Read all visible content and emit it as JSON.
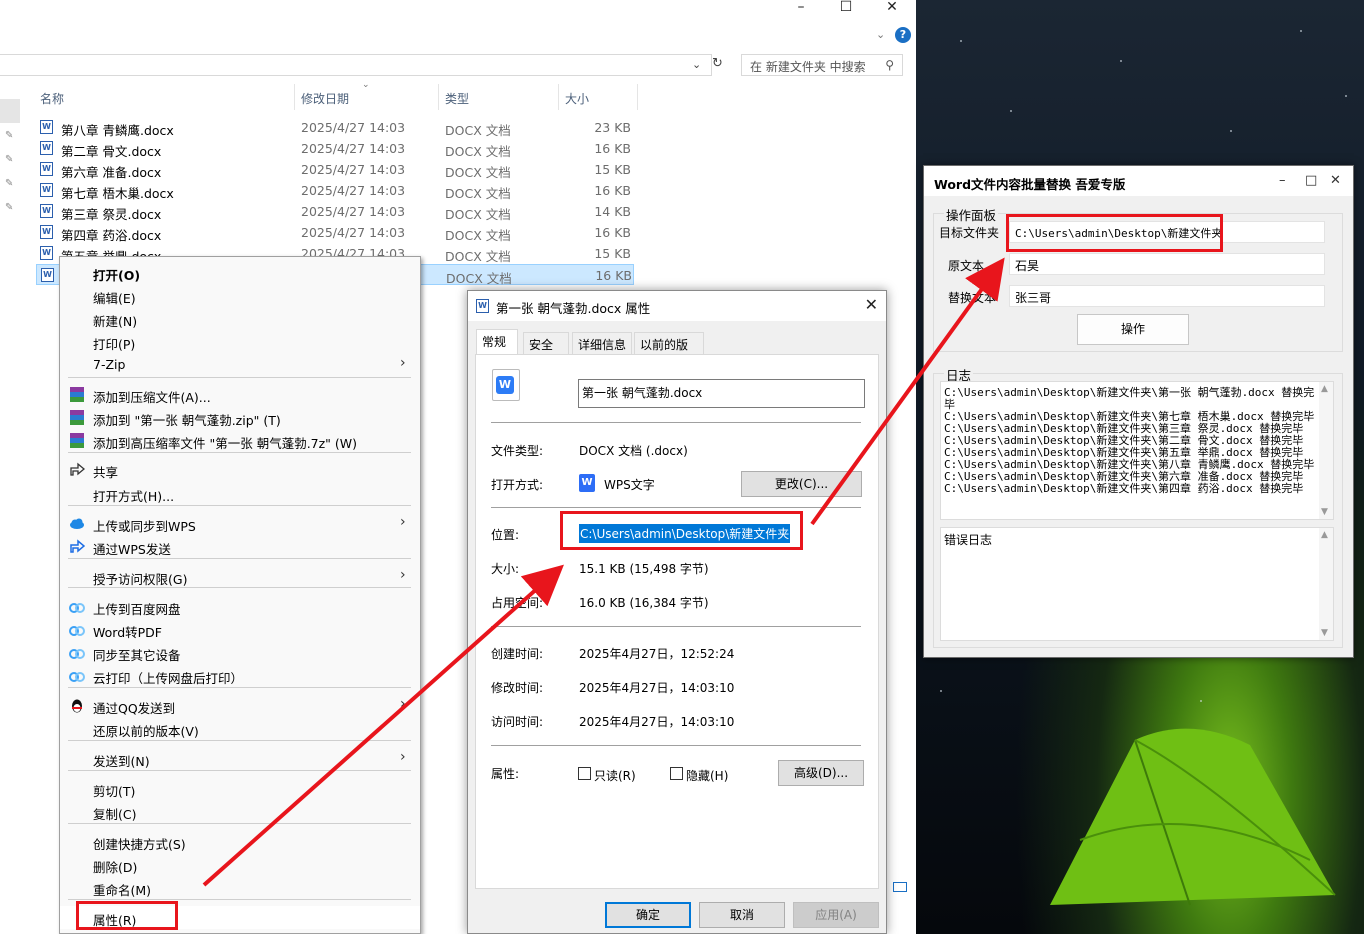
{
  "explorer": {
    "search_placeholder": "在 新建文件夹 中搜索",
    "columns": {
      "name": "名称",
      "date": "修改日期",
      "type": "类型",
      "size": "大小"
    },
    "files": [
      {
        "name": "第八章 青鳞鹰.docx",
        "date": "2025/4/27 14:03",
        "type": "DOCX 文档",
        "size": "23 KB"
      },
      {
        "name": "第二章 骨文.docx",
        "date": "2025/4/27 14:03",
        "type": "DOCX 文档",
        "size": "16 KB"
      },
      {
        "name": "第六章 准备.docx",
        "date": "2025/4/27 14:03",
        "type": "DOCX 文档",
        "size": "15 KB"
      },
      {
        "name": "第七章 梧木巢.docx",
        "date": "2025/4/27 14:03",
        "type": "DOCX 文档",
        "size": "16 KB"
      },
      {
        "name": "第三章 祭灵.docx",
        "date": "2025/4/27 14:03",
        "type": "DOCX 文档",
        "size": "14 KB"
      },
      {
        "name": "第四章 药浴.docx",
        "date": "2025/4/27 14:03",
        "type": "DOCX 文档",
        "size": "16 KB"
      },
      {
        "name": "第五章 举鼎.docx",
        "date": "2025/4/27 14:03",
        "type": "DOCX 文档",
        "size": "15 KB"
      },
      {
        "name": "",
        "date": "",
        "type": "DOCX 文档",
        "size": "16 KB"
      }
    ]
  },
  "context_menu": {
    "items": [
      "打开(O)",
      "编辑(E)",
      "新建(N)",
      "打印(P)",
      "7-Zip",
      "添加到压缩文件(A)...",
      "添加到 \"第一张 朝气蓬勃.zip\" (T)",
      "添加到高压缩率文件 \"第一张 朝气蓬勃.7z\" (W)",
      "共享",
      "打开方式(H)...",
      "上传或同步到WPS",
      "通过WPS发送",
      "授予访问权限(G)",
      "上传到百度网盘",
      "Word转PDF",
      "同步至其它设备",
      "云打印（上传网盘后打印）",
      "通过QQ发送到",
      "还原以前的版本(V)",
      "发送到(N)",
      "剪切(T)",
      "复制(C)",
      "创建快捷方式(S)",
      "删除(D)",
      "重命名(M)",
      "属性(R)"
    ]
  },
  "properties": {
    "title": "第一张 朝气蓬勃.docx 属性",
    "tabs": [
      "常规",
      "安全",
      "详细信息",
      "以前的版本"
    ],
    "filename": "第一张 朝气蓬勃.docx",
    "labels": {
      "file_type": "文件类型:",
      "open_with": "打开方式:",
      "location": "位置:",
      "size": "大小:",
      "size_on_disk": "占用空间:",
      "created": "创建时间:",
      "modified": "修改时间:",
      "accessed": "访问时间:",
      "attributes": "属性:"
    },
    "values": {
      "file_type": "DOCX 文档 (.docx)",
      "open_with": "WPS文字",
      "location": "C:\\Users\\admin\\Desktop\\新建文件夹",
      "size": "15.1 KB (15,498 字节)",
      "size_on_disk": "16.0 KB (16,384 字节)",
      "created": "2025年4月27日，12:52:24",
      "modified": "2025年4月27日，14:03:10",
      "accessed": "2025年4月27日，14:03:10"
    },
    "readonly_label": "只读(R)",
    "hidden_label": "隐藏(H)",
    "change_button": "更改(C)...",
    "advanced_button": "高级(D)...",
    "ok_button": "确定",
    "cancel_button": "取消",
    "apply_button": "应用(A)"
  },
  "tool": {
    "title": "Word文件内容批量替换 吾爱专版",
    "group_label": "操作面板",
    "target_label": "目标文件夹",
    "target_value": "C:\\Users\\admin\\Desktop\\新建文件夹",
    "original_label": "原文本",
    "original_value": "石昊",
    "replace_label": "替换文本",
    "replace_value": "张三哥",
    "action_button": "操作",
    "log_label": "日志",
    "log_text": "C:\\Users\\admin\\Desktop\\新建文件夹\\第一张 朝气蓬勃.docx 替换完毕\nC:\\Users\\admin\\Desktop\\新建文件夹\\第七章 梧木巢.docx 替换完毕\nC:\\Users\\admin\\Desktop\\新建文件夹\\第三章 祭灵.docx 替换完毕\nC:\\Users\\admin\\Desktop\\新建文件夹\\第二章 骨文.docx 替换完毕\nC:\\Users\\admin\\Desktop\\新建文件夹\\第五章 举鼎.docx 替换完毕\nC:\\Users\\admin\\Desktop\\新建文件夹\\第八章 青鳞鹰.docx 替换完毕\nC:\\Users\\admin\\Desktop\\新建文件夹\\第六章 准备.docx 替换完毕\nC:\\Users\\admin\\Desktop\\新建文件夹\\第四章 药浴.docx 替换完毕",
    "error_log_label": "错误日志"
  },
  "colors": {
    "highlight_red": "#e8151c",
    "selection_blue": "#0078d7"
  }
}
